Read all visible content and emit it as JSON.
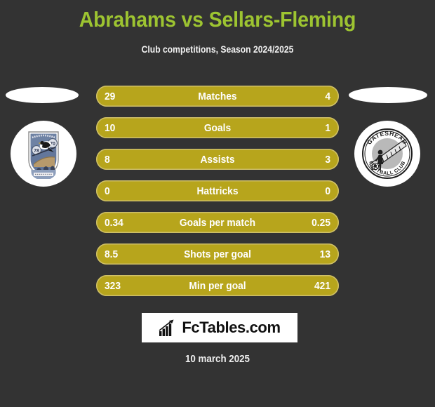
{
  "page": {
    "background_color": "#333333",
    "title": "Abrahams vs Sellars-Fleming",
    "title_color": "#9dc431",
    "subtitle": "Club competitions, Season 2024/2025",
    "date": "10 march 2025"
  },
  "teams": {
    "home": {
      "badge_name": "notts-county-badge",
      "badge_alt": "Club badge with magpies on a bridge"
    },
    "away": {
      "badge_name": "gateshead-badge",
      "badge_top_text": "GATESHEAD",
      "badge_bottom_text": "FOOTBALL CLUB"
    }
  },
  "stats": {
    "bar_color": "#b7a51c",
    "bar_border_color": "#cfc06a",
    "rows": [
      {
        "label": "Matches",
        "home": "29",
        "away": "4"
      },
      {
        "label": "Goals",
        "home": "10",
        "away": "1"
      },
      {
        "label": "Assists",
        "home": "8",
        "away": "3"
      },
      {
        "label": "Hattricks",
        "home": "0",
        "away": "0"
      },
      {
        "label": "Goals per match",
        "home": "0.34",
        "away": "0.25"
      },
      {
        "label": "Shots per goal",
        "home": "8.5",
        "away": "13"
      },
      {
        "label": "Min per goal",
        "home": "323",
        "away": "421"
      }
    ]
  },
  "brand": {
    "icon": "bar-chart-icon",
    "text": "FcTables.com"
  },
  "chart_data": {
    "type": "table",
    "title": "Abrahams vs Sellars-Fleming",
    "subtitle": "Club competitions, Season 2024/2025",
    "categories": [
      "Matches",
      "Goals",
      "Assists",
      "Hattricks",
      "Goals per match",
      "Shots per goal",
      "Min per goal"
    ],
    "series": [
      {
        "name": "Abrahams",
        "values": [
          29,
          10,
          8,
          0,
          0.34,
          8.5,
          323
        ]
      },
      {
        "name": "Sellars-Fleming",
        "values": [
          4,
          1,
          3,
          0,
          0.25,
          13,
          421
        ]
      }
    ],
    "xlabel": "",
    "ylabel": "",
    "legend": [
      "Abrahams",
      "Sellars-Fleming"
    ],
    "grid": false
  }
}
